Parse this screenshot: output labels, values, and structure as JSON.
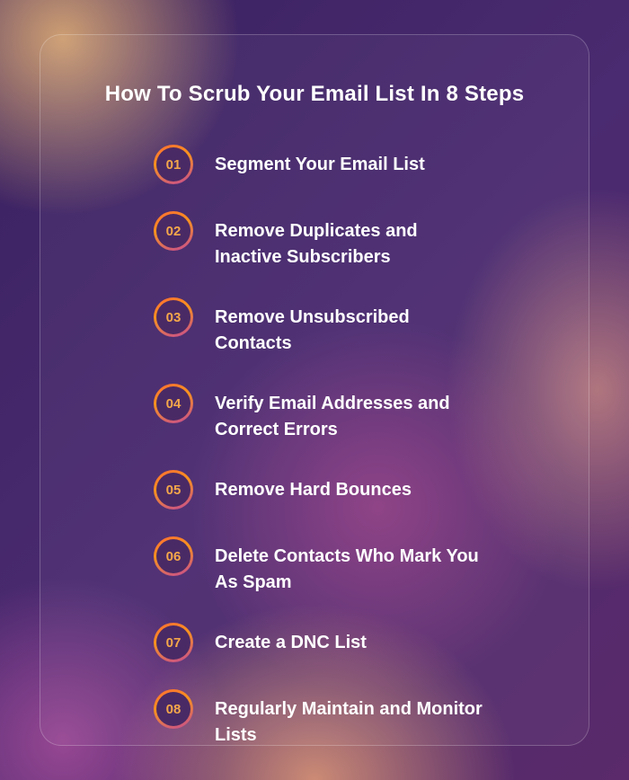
{
  "title": "How To Scrub Your Email List In 8 Steps",
  "steps": [
    {
      "num": "01",
      "text": "Segment Your Email List"
    },
    {
      "num": "02",
      "text": "Remove Duplicates and Inactive Subscribers"
    },
    {
      "num": "03",
      "text": "Remove Unsubscribed Contacts"
    },
    {
      "num": "04",
      "text": "Verify Email Addresses and Correct Errors"
    },
    {
      "num": "05",
      "text": "Remove Hard Bounces"
    },
    {
      "num": "06",
      "text": "Delete Contacts Who Mark You As Spam"
    },
    {
      "num": "07",
      "text": "Create a DNC List"
    },
    {
      "num": "08",
      "text": "Regularly Maintain and Monitor Lists"
    }
  ]
}
